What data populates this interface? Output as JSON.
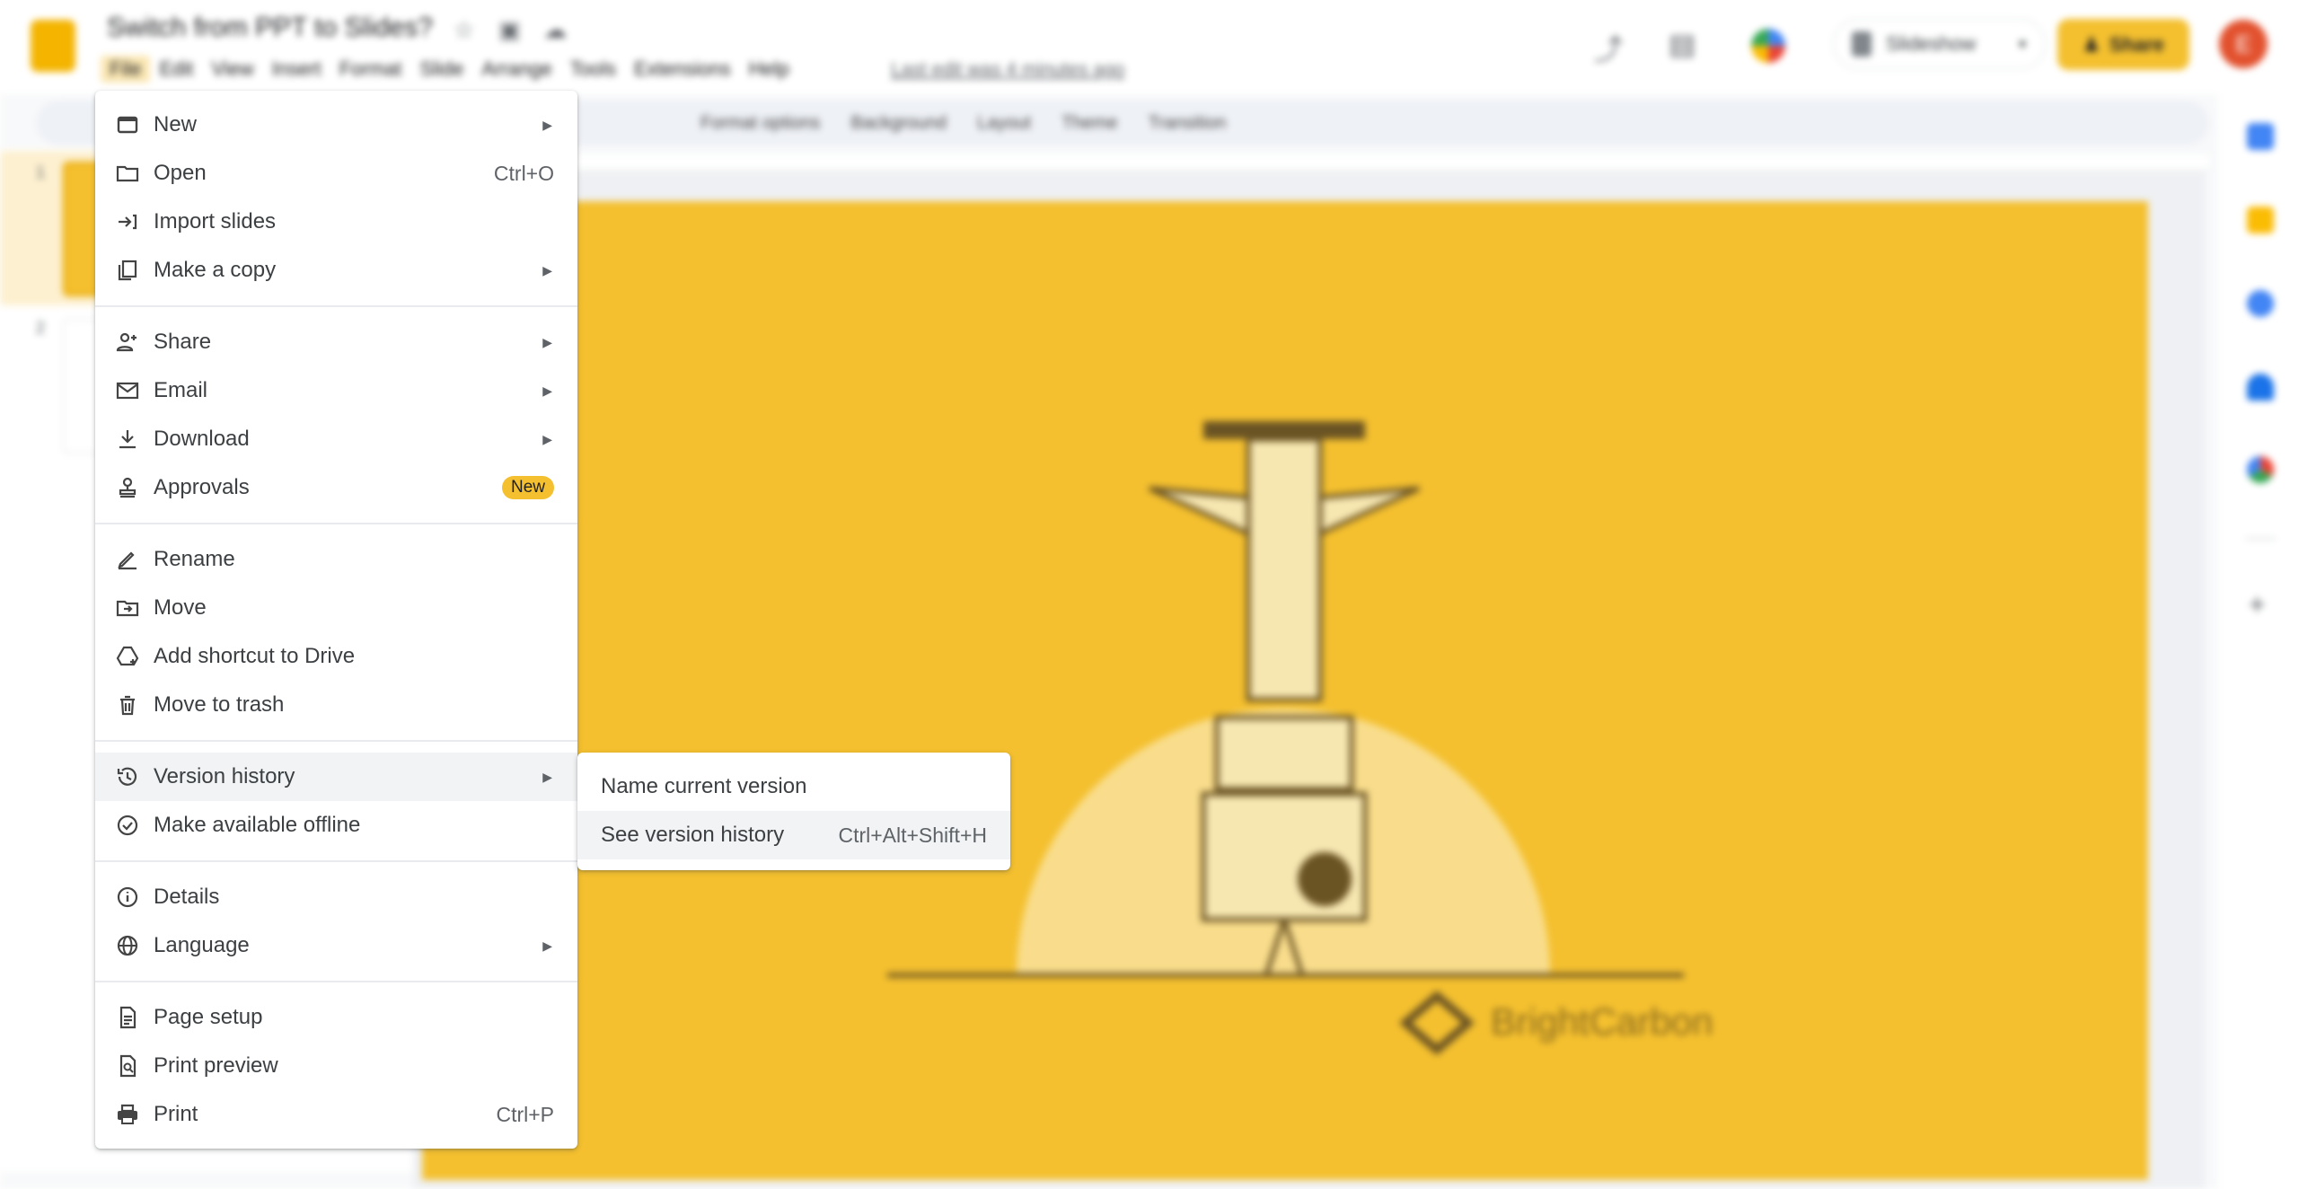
{
  "header": {
    "doc_title": "Switch from PPT to Slides?",
    "menus": [
      "File",
      "Edit",
      "View",
      "Insert",
      "Format",
      "Slide",
      "Arrange",
      "Tools",
      "Extensions",
      "Help"
    ],
    "active_menu": "File",
    "last_edit": "Last edit was 4 minutes ago",
    "slideshow_label": "Slideshow",
    "share_label": "Share",
    "avatar_letter": "E"
  },
  "toolbar": {
    "items": [
      "Format options",
      "Background",
      "Layout",
      "Theme",
      "Transition"
    ]
  },
  "filmstrip": {
    "slide_numbers": [
      "1",
      "2"
    ]
  },
  "slide": {
    "logo_text": "BrightCarbon"
  },
  "colors": {
    "accent": "#f4c02f",
    "slide_bg": "#f4c02f",
    "avatar": "#e2512e",
    "menu_highlight": "#f1f3f4"
  },
  "file_menu": {
    "groups": [
      [
        {
          "label": "New",
          "icon": "slides-icon",
          "submenu": true
        },
        {
          "label": "Open",
          "icon": "folder-icon",
          "shortcut": "Ctrl+O"
        },
        {
          "label": "Import slides",
          "icon": "import-icon"
        },
        {
          "label": "Make a copy",
          "icon": "copy-icon",
          "submenu": true
        }
      ],
      [
        {
          "label": "Share",
          "icon": "person-add-icon",
          "submenu": true
        },
        {
          "label": "Email",
          "icon": "mail-icon",
          "submenu": true
        },
        {
          "label": "Download",
          "icon": "download-icon",
          "submenu": true
        },
        {
          "label": "Approvals",
          "icon": "stamp-icon",
          "badge": "New"
        }
      ],
      [
        {
          "label": "Rename",
          "icon": "rename-icon"
        },
        {
          "label": "Move",
          "icon": "move-folder-icon"
        },
        {
          "label": "Add shortcut to Drive",
          "icon": "drive-shortcut-icon"
        },
        {
          "label": "Move to trash",
          "icon": "trash-icon"
        }
      ],
      [
        {
          "label": "Version history",
          "icon": "history-icon",
          "submenu": true,
          "highlighted": true
        },
        {
          "label": "Make available offline",
          "icon": "offline-icon"
        }
      ],
      [
        {
          "label": "Details",
          "icon": "info-icon"
        },
        {
          "label": "Language",
          "icon": "globe-icon",
          "submenu": true
        }
      ],
      [
        {
          "label": "Page setup",
          "icon": "page-icon"
        },
        {
          "label": "Print preview",
          "icon": "print-preview-icon"
        },
        {
          "label": "Print",
          "icon": "print-icon",
          "shortcut": "Ctrl+P"
        }
      ]
    ]
  },
  "version_submenu": {
    "items": [
      {
        "label": "Name current version"
      },
      {
        "label": "See version history",
        "shortcut": "Ctrl+Alt+Shift+H",
        "highlighted": true
      }
    ]
  }
}
